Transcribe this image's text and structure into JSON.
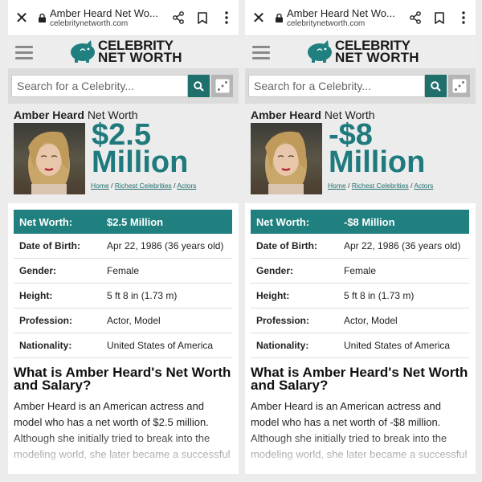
{
  "browser": {
    "title": "Amber Heard Net Wo...",
    "domain": "celebritynetworth.com"
  },
  "site": {
    "logo_line1": "CELEBRITY",
    "logo_line2": "NET WORTH",
    "search_placeholder": "Search for a Celebrity..."
  },
  "celebrity": {
    "name": "Amber Heard",
    "name_suffix": "Net Worth",
    "breadcrumb": [
      "Home",
      "Richest Celebrities",
      "Actors"
    ],
    "breadcrumb_sep": "/"
  },
  "panes": [
    {
      "networth_big_line1": "$2.5",
      "networth_big_line2": "Million",
      "networth_row_value": "$2.5 Million",
      "article_p": "Amber Heard is an American actress and model who has a net worth of $2.5 million. Although she initially tried to break into the modeling world, she later became a successful actress. Known for her starring roles in various films,"
    },
    {
      "networth_big_line1": "-$8",
      "networth_big_line2": "Million",
      "networth_row_value": "-$8 Million",
      "article_p": "Amber Heard is an American actress and model who has a net worth of -$8 million. Although she initially tried to break into the modeling world, she later became a successful actress. Known for her starring roles in various films,"
    }
  ],
  "facts": {
    "networth_label": "Net Worth:",
    "rows": [
      {
        "label": "Date of Birth:",
        "value": "Apr 22, 1986 (36 years old)"
      },
      {
        "label": "Gender:",
        "value": "Female"
      },
      {
        "label": "Height:",
        "value": "5 ft 8 in (1.73 m)"
      },
      {
        "label": "Profession:",
        "value": "Actor, Model"
      },
      {
        "label": "Nationality:",
        "value": "United States of America"
      }
    ]
  },
  "article": {
    "heading": "What is Amber Heard's Net Worth and Salary?"
  },
  "colors": {
    "accent": "#1f807f",
    "networth_text": "#1f7a7d"
  },
  "icons": [
    "close-icon",
    "lock-icon",
    "share-icon",
    "bookmark-icon",
    "more-icon",
    "hamburger-icon",
    "pig-logo-icon",
    "search-icon",
    "dice-icon"
  ]
}
